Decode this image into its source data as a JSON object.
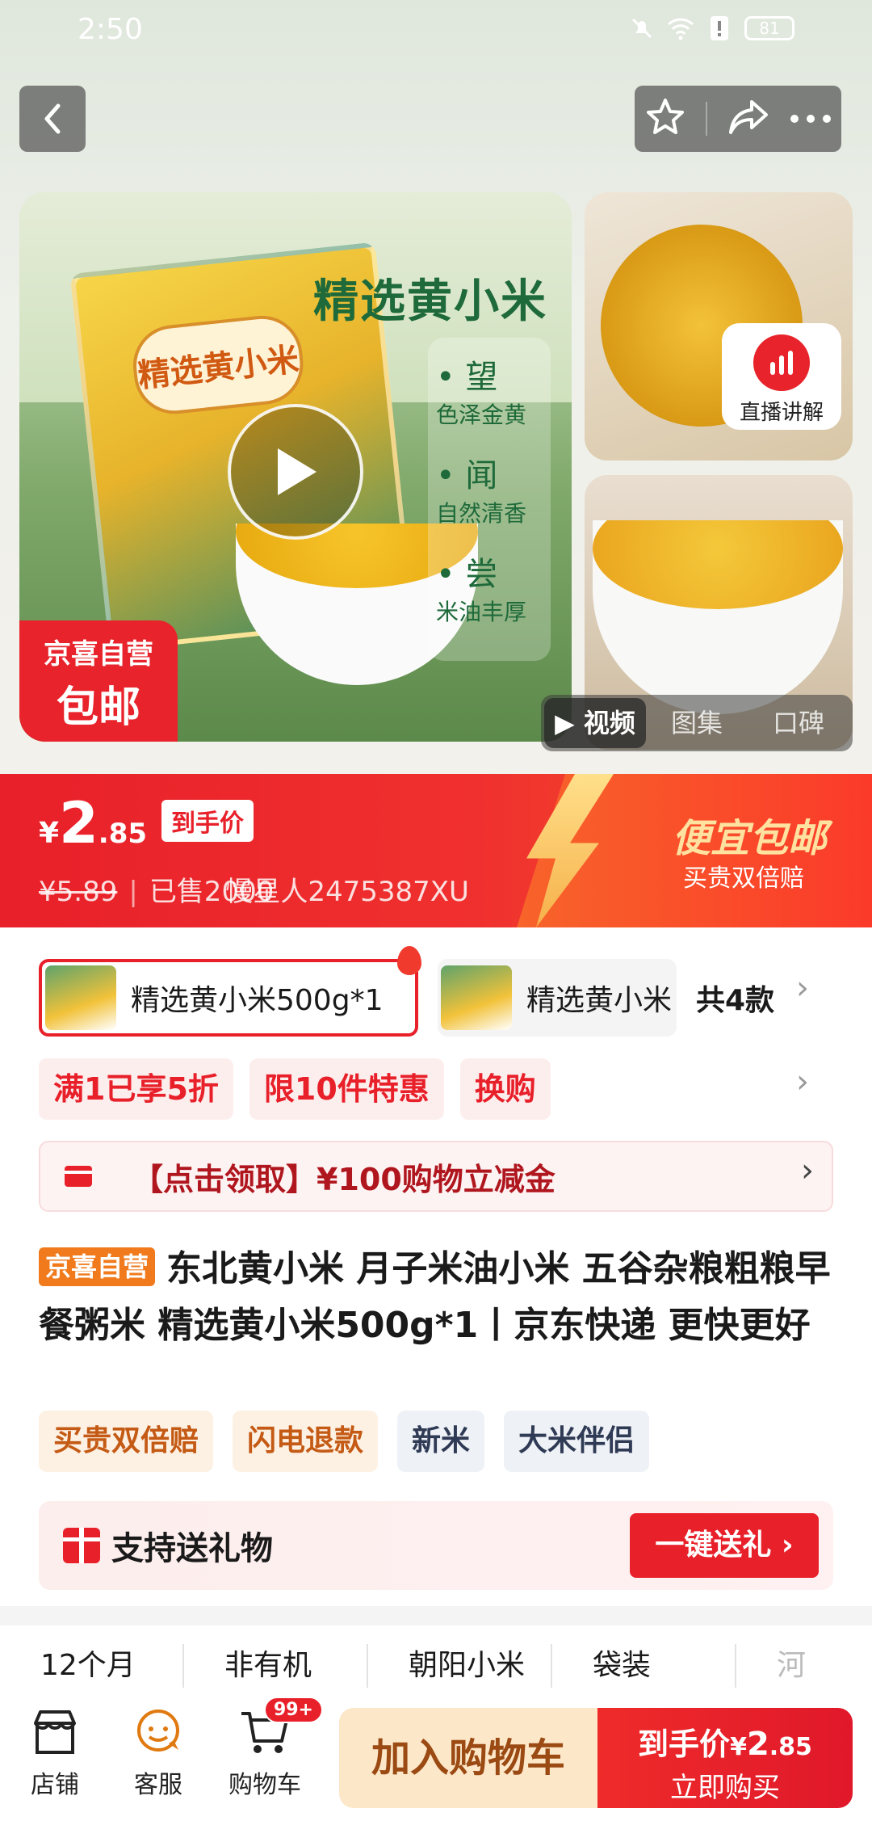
{
  "status": {
    "time": "2:50",
    "battery": "81"
  },
  "gallery": {
    "headline": "精选黄小米",
    "features": [
      {
        "big": "望",
        "small": "色泽金黄"
      },
      {
        "big": "闻",
        "small": "自然清香"
      },
      {
        "big": "尝",
        "small": "米油丰厚"
      }
    ],
    "package_label": "精选黄小米",
    "badge_line1": "京喜自营",
    "badge_line2": "包邮",
    "live_label": "直播讲解",
    "media_tabs": [
      "视频",
      "图集",
      "口碑"
    ]
  },
  "price": {
    "currency": "¥",
    "integer": "2",
    "decimal": ".85",
    "tag": "到手价",
    "original": "¥5.89",
    "sold": "已售2000",
    "sold_overlay": "慢星人2475387XU",
    "promo_title": "便宜包邮",
    "promo_sub": "买贵双倍赔"
  },
  "variants": {
    "selected": "精选黄小米500g*1",
    "other": "精选黄小米",
    "total": "共4款"
  },
  "deals": [
    "满1已享5折",
    "限10件特惠",
    "换购"
  ],
  "coupon": "【点击领取】¥100购物立减金",
  "product": {
    "tag": "京喜自营",
    "title": "东北黄小米 月子米油小米 五谷杂粮粗粮早餐粥米 精选黄小米500g*1丨京东快递 更快更好"
  },
  "service_tags": [
    {
      "label": "买贵双倍赔",
      "style": "warm"
    },
    {
      "label": "闪电退款",
      "style": "warm"
    },
    {
      "label": "新米",
      "style": "cool"
    },
    {
      "label": "大米伴侣",
      "style": "cool"
    }
  ],
  "gift": {
    "label": "支持送礼物",
    "button": "一键送礼 ›"
  },
  "attributes": [
    "12个月",
    "非有机",
    "朝阳小米",
    "袋装",
    "河"
  ],
  "bottom": {
    "shop": "店铺",
    "service": "客服",
    "cart": "购物车",
    "cart_badge": "99+",
    "add_cart": "加入购物车",
    "buy_price_label": "到手价",
    "buy_currency": "¥",
    "buy_int": "2",
    "buy_dec": ".85",
    "buy_now": "立即购买"
  },
  "colors": {
    "accent": "#e8202a",
    "orange_tag": "#f07a1c",
    "cart_bg": "#fde7c9"
  }
}
